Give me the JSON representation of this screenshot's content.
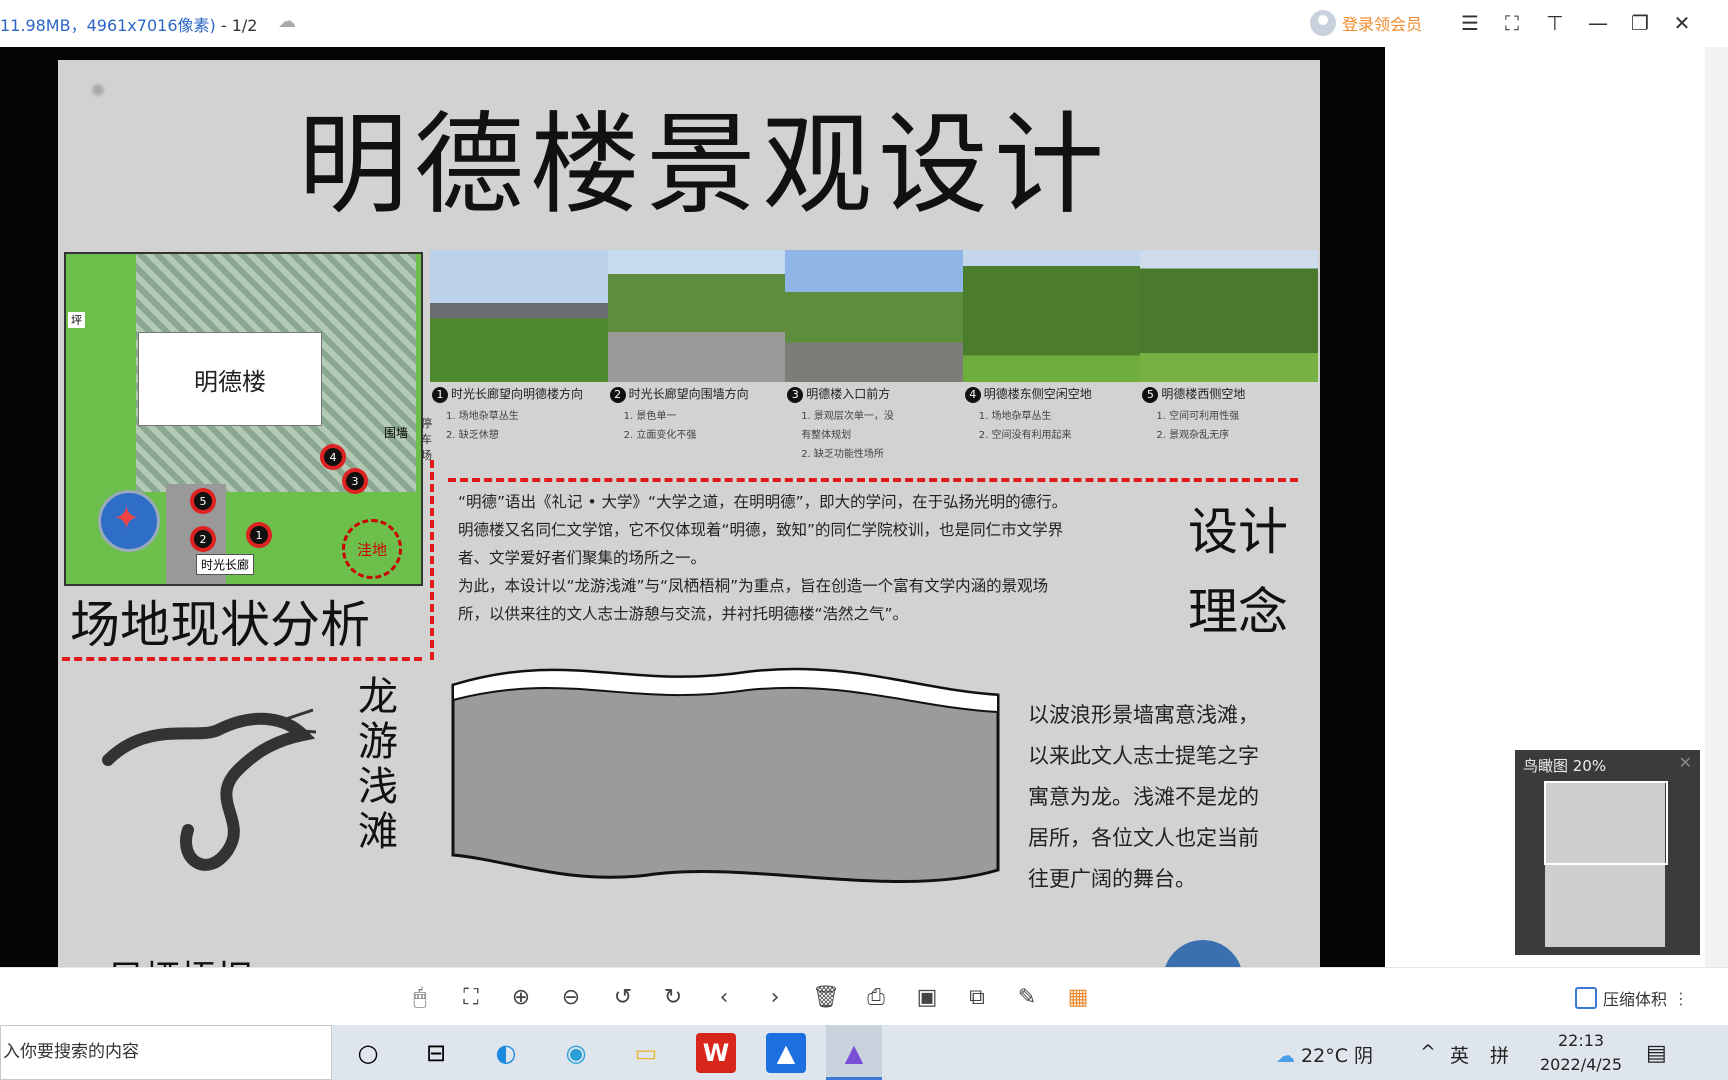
{
  "titlebar": {
    "file_info": "11.98MB，4961x7016像素)",
    "page": " - 1/2",
    "login_text": "登录领会员"
  },
  "poster": {
    "title": "明德楼景观设计",
    "site_plan": {
      "building": "明德楼",
      "label_bottom": "时光长廊",
      "pool": "洼地",
      "label_left": "坪",
      "label_right": "围墙",
      "markers": [
        "1",
        "2",
        "3",
        "4",
        "5"
      ]
    },
    "section_site": "场地现状分析",
    "side_label": "停车场",
    "photos": [
      {
        "num": "1",
        "caption": "时光长廊望向明德楼方向",
        "notes": [
          "1. 场地杂草丛生",
          "2. 缺乏休憩"
        ]
      },
      {
        "num": "2",
        "caption": "时光长廊望向围墙方向",
        "notes": [
          "1. 景色单一",
          "2. 立面变化不强"
        ]
      },
      {
        "num": "3",
        "caption": "明德楼入口前方",
        "notes": [
          "1. 景观层次单一，没",
          "有整体规划",
          "2. 缺乏功能性场所"
        ]
      },
      {
        "num": "4",
        "caption": "明德楼东侧空闲空地",
        "notes": [
          "1. 场地杂草丛生",
          "2. 空间没有利用起来"
        ]
      },
      {
        "num": "5",
        "caption": "明德楼西侧空地",
        "notes": [
          "1. 空间可利用性强",
          "2. 景观杂乱无序"
        ]
      }
    ],
    "concept_lines": [
      "“明德”语出《礼记 • 大学》“大学之道，在明明德”，即大的学问，在于弘扬光明的德行。",
      "明德楼又名同仁文学馆，它不仅体现着“明德，致知”的同仁学院校训，也是同仁市文学界",
      "者、文学爱好者们聚集的场所之一。",
      "为此，本设计以“龙游浅滩”与“凤栖梧桐”为重点，旨在创造一个富有文学内涵的景观场",
      "所，以供来往的文人志士游憩与交流，并衬托明德楼“浩然之气”。"
    ],
    "section_concept": "设计理念",
    "dragon_title": "龙游浅滩",
    "wave_text": [
      "以波浪形景墙寓意浅滩，",
      "以来此文人志士提笔之字",
      "寓意为龙。浅滩不是龙的",
      "居所，各位文人也定当前",
      "往更广阔的舞台。"
    ],
    "section_bottom": "凤栖梧桐"
  },
  "minimap": {
    "title": "鸟瞰图 20%"
  },
  "toolbar": {
    "compress_label": "压缩体积",
    "icons": [
      "mouse-icon",
      "fit-screen-icon",
      "zoom-in-icon",
      "zoom-out-icon",
      "rotate-left-icon",
      "rotate-right-icon",
      "prev-icon",
      "next-icon",
      "delete-icon",
      "print-icon",
      "ocr-icon",
      "extract-icon",
      "edit-icon",
      "apps-icon"
    ]
  },
  "taskbar": {
    "search_placeholder": "入你要搜索的内容",
    "weather": "22°C  阴",
    "ime_lang": "英",
    "ime_mode": "拼",
    "time": "22:13",
    "date": "2022/4/25"
  },
  "colors": {
    "accent_blue": "#2b66c6",
    "login_orange": "#f08c2c",
    "dash_red": "#e0191b"
  }
}
